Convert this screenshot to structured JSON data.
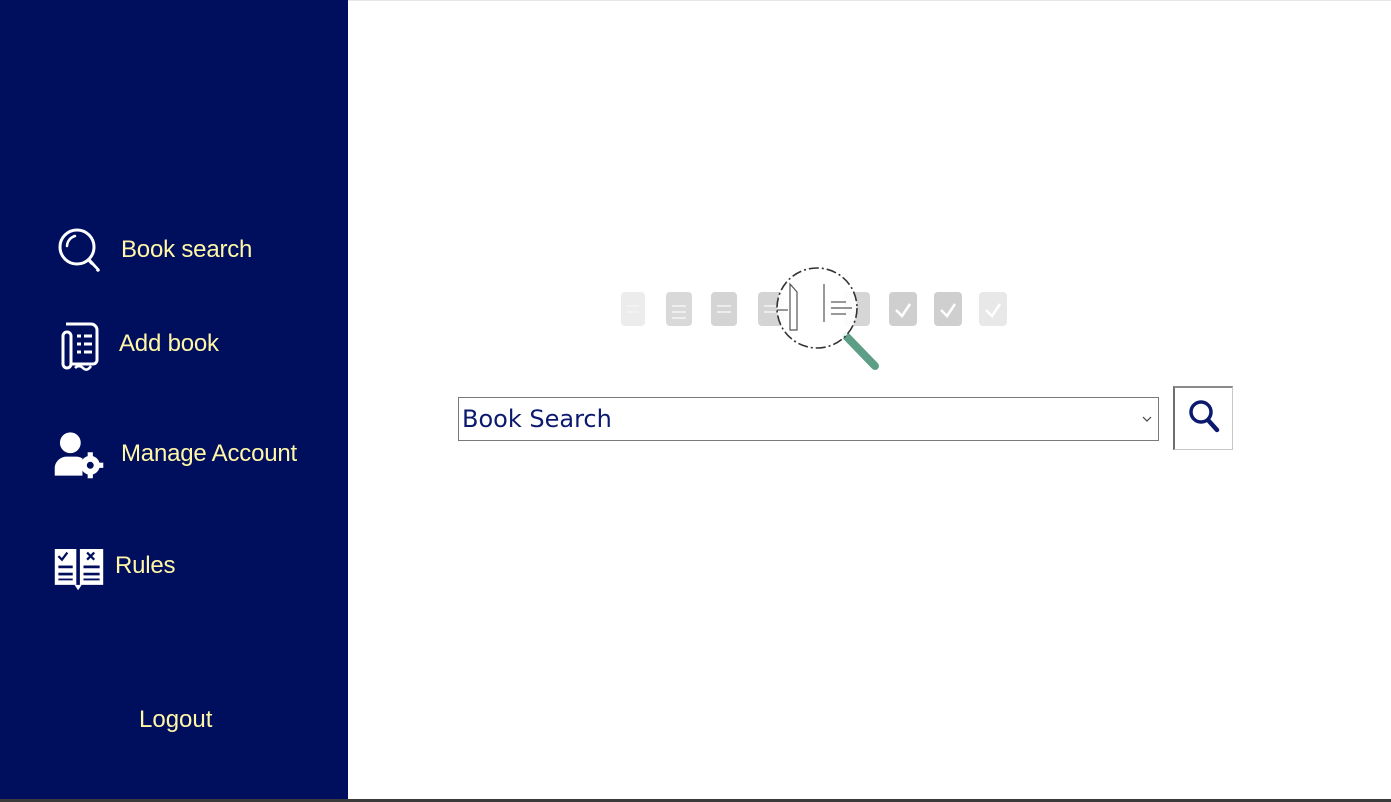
{
  "sidebar": {
    "items": [
      {
        "label": "Book search",
        "icon": "magnifier-icon"
      },
      {
        "label": "Add book",
        "icon": "document-list-icon"
      },
      {
        "label": "Manage Account",
        "icon": "user-settings-icon"
      },
      {
        "label": "Rules",
        "icon": "rulebook-icon"
      }
    ],
    "logout_label": "Logout"
  },
  "search": {
    "value": "Book Search"
  },
  "colors": {
    "sidebar_bg": "#000e5e",
    "sidebar_text": "#fff7a6",
    "search_text": "#0b1a6e",
    "illustration_handle": "#5c9f86"
  }
}
